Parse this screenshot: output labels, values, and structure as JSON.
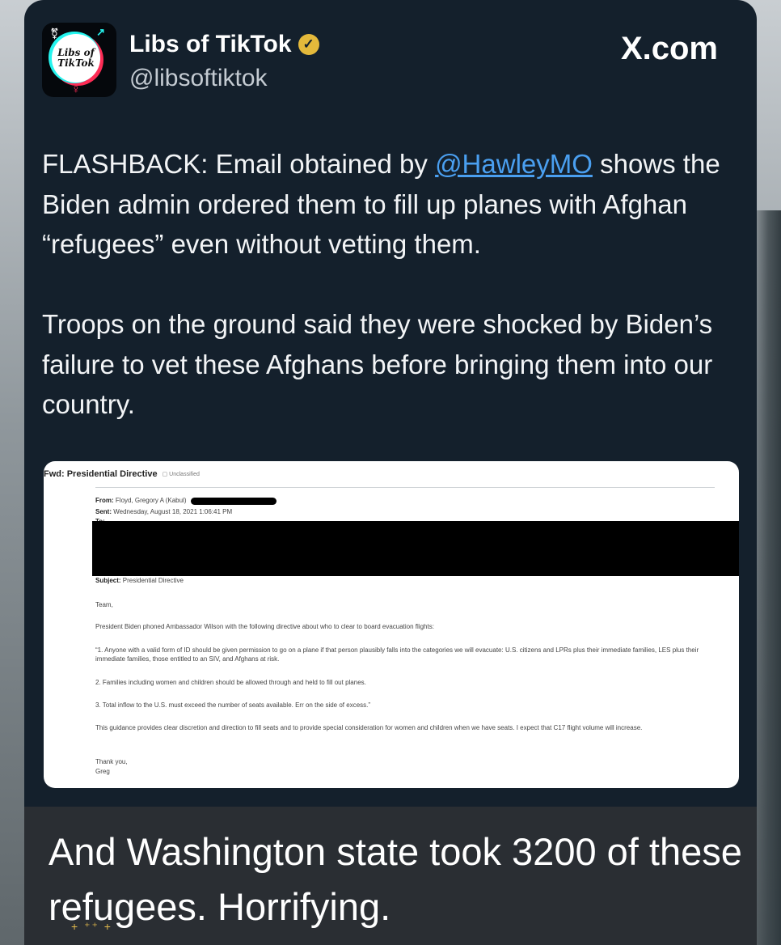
{
  "post": {
    "display_name": "Libs of TikTok",
    "handle": "@libsoftiktok",
    "brand": "X.com",
    "avatar_line1": "Libs of",
    "avatar_line2": "TikTok",
    "text_before_mention": "FLASHBACK: Email obtained by ",
    "mention": "@HawleyMO",
    "text_after_mention": " shows the Biden admin ordered them to fill up planes with Afghan “refugees” even without vetting them.\n\nTroops on the ground said they were shocked by Biden’s failure to vet these Afghans before bringing them into our country."
  },
  "email": {
    "subject_title": "Fwd: Presidential Directive",
    "classification": "Unclassified",
    "from_label": "From:",
    "from_value": "Floyd, Gregory A (Kabul)",
    "sent_label": "Sent:",
    "sent_value": "Wednesday, August 18, 2021 1:06:41 PM",
    "to_label": "To:",
    "subject_label": "Subject:",
    "subject_value": "Presidential Directive",
    "greeting": "Team,",
    "intro": "President Biden phoned Ambassador Wilson with the following directive about who to clear to board evacuation flights:",
    "item1": "“1. Anyone with a valid form of ID should be given permission to go on a plane if that person plausibly falls into the categories we will evacuate: U.S. citizens and LPRs plus their immediate families, LES plus their immediate families, those entitled to an SIV, and Afghans at risk.",
    "item2": "2. Families including women and children should be allowed through and held to fill out planes.",
    "item3": "3. Total inflow to the U.S. must exceed the number of seats available. Err on the side of excess.”",
    "guidance": "This guidance provides clear discretion and direction to fill seats and to provide special consideration for women and children when we have seats. I expect that C17 flight volume will increase.",
    "signoff": "Thank you,",
    "signature": "Greg"
  },
  "caption": {
    "text": "And Washington state took 3200 of these refugees. Horrifying."
  },
  "colors": {
    "card_bg": "#14202c",
    "link": "#4a9ff0",
    "verified_badge": "#e4b93b",
    "caption_bg": "#2a2e33"
  },
  "icons": [
    "verified-badge-icon",
    "libs-of-tiktok-logo",
    "sparkle-icon"
  ]
}
